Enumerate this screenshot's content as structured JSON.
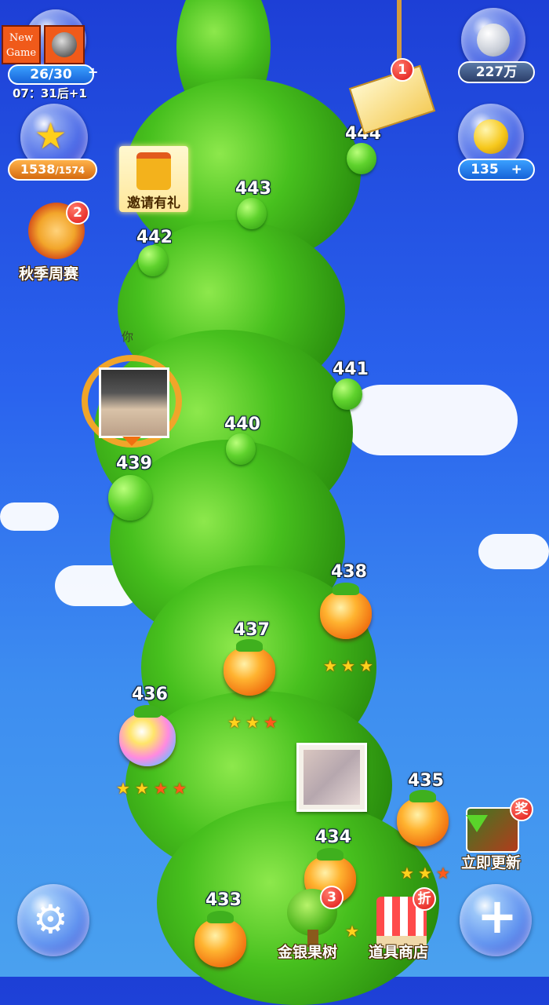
{
  "top_left_buttons": {
    "new_game": "New Game"
  },
  "hud": {
    "lives": "26/30",
    "lives_plus": "+",
    "timer": "07：31后+1",
    "stars": "1538",
    "stars_total": "/1574",
    "coins": "227万",
    "gold": "135",
    "gold_plus": "+"
  },
  "invite": {
    "label": "邀请有礼"
  },
  "weekly": {
    "label": "秋季周赛",
    "badge": "2"
  },
  "mail": {
    "badge": "1"
  },
  "player": {
    "you_label": "你"
  },
  "levels": [
    {
      "num": "433"
    },
    {
      "num": "434"
    },
    {
      "num": "435"
    },
    {
      "num": "436"
    },
    {
      "num": "437"
    },
    {
      "num": "438"
    },
    {
      "num": "439"
    },
    {
      "num": "440"
    },
    {
      "num": "441"
    },
    {
      "num": "442"
    },
    {
      "num": "443"
    },
    {
      "num": "444"
    }
  ],
  "bottom": {
    "tree_label": "金银果树",
    "tree_badge": "3",
    "shop_label": "道具商店",
    "shop_badge": "折",
    "update_label": "立即更新",
    "update_badge": "奖"
  },
  "colors": {
    "sky_top": "#1d3fd6",
    "sky_bottom": "#4aa1ef",
    "stalk": "#47c01e",
    "fruit": "#f07010"
  }
}
